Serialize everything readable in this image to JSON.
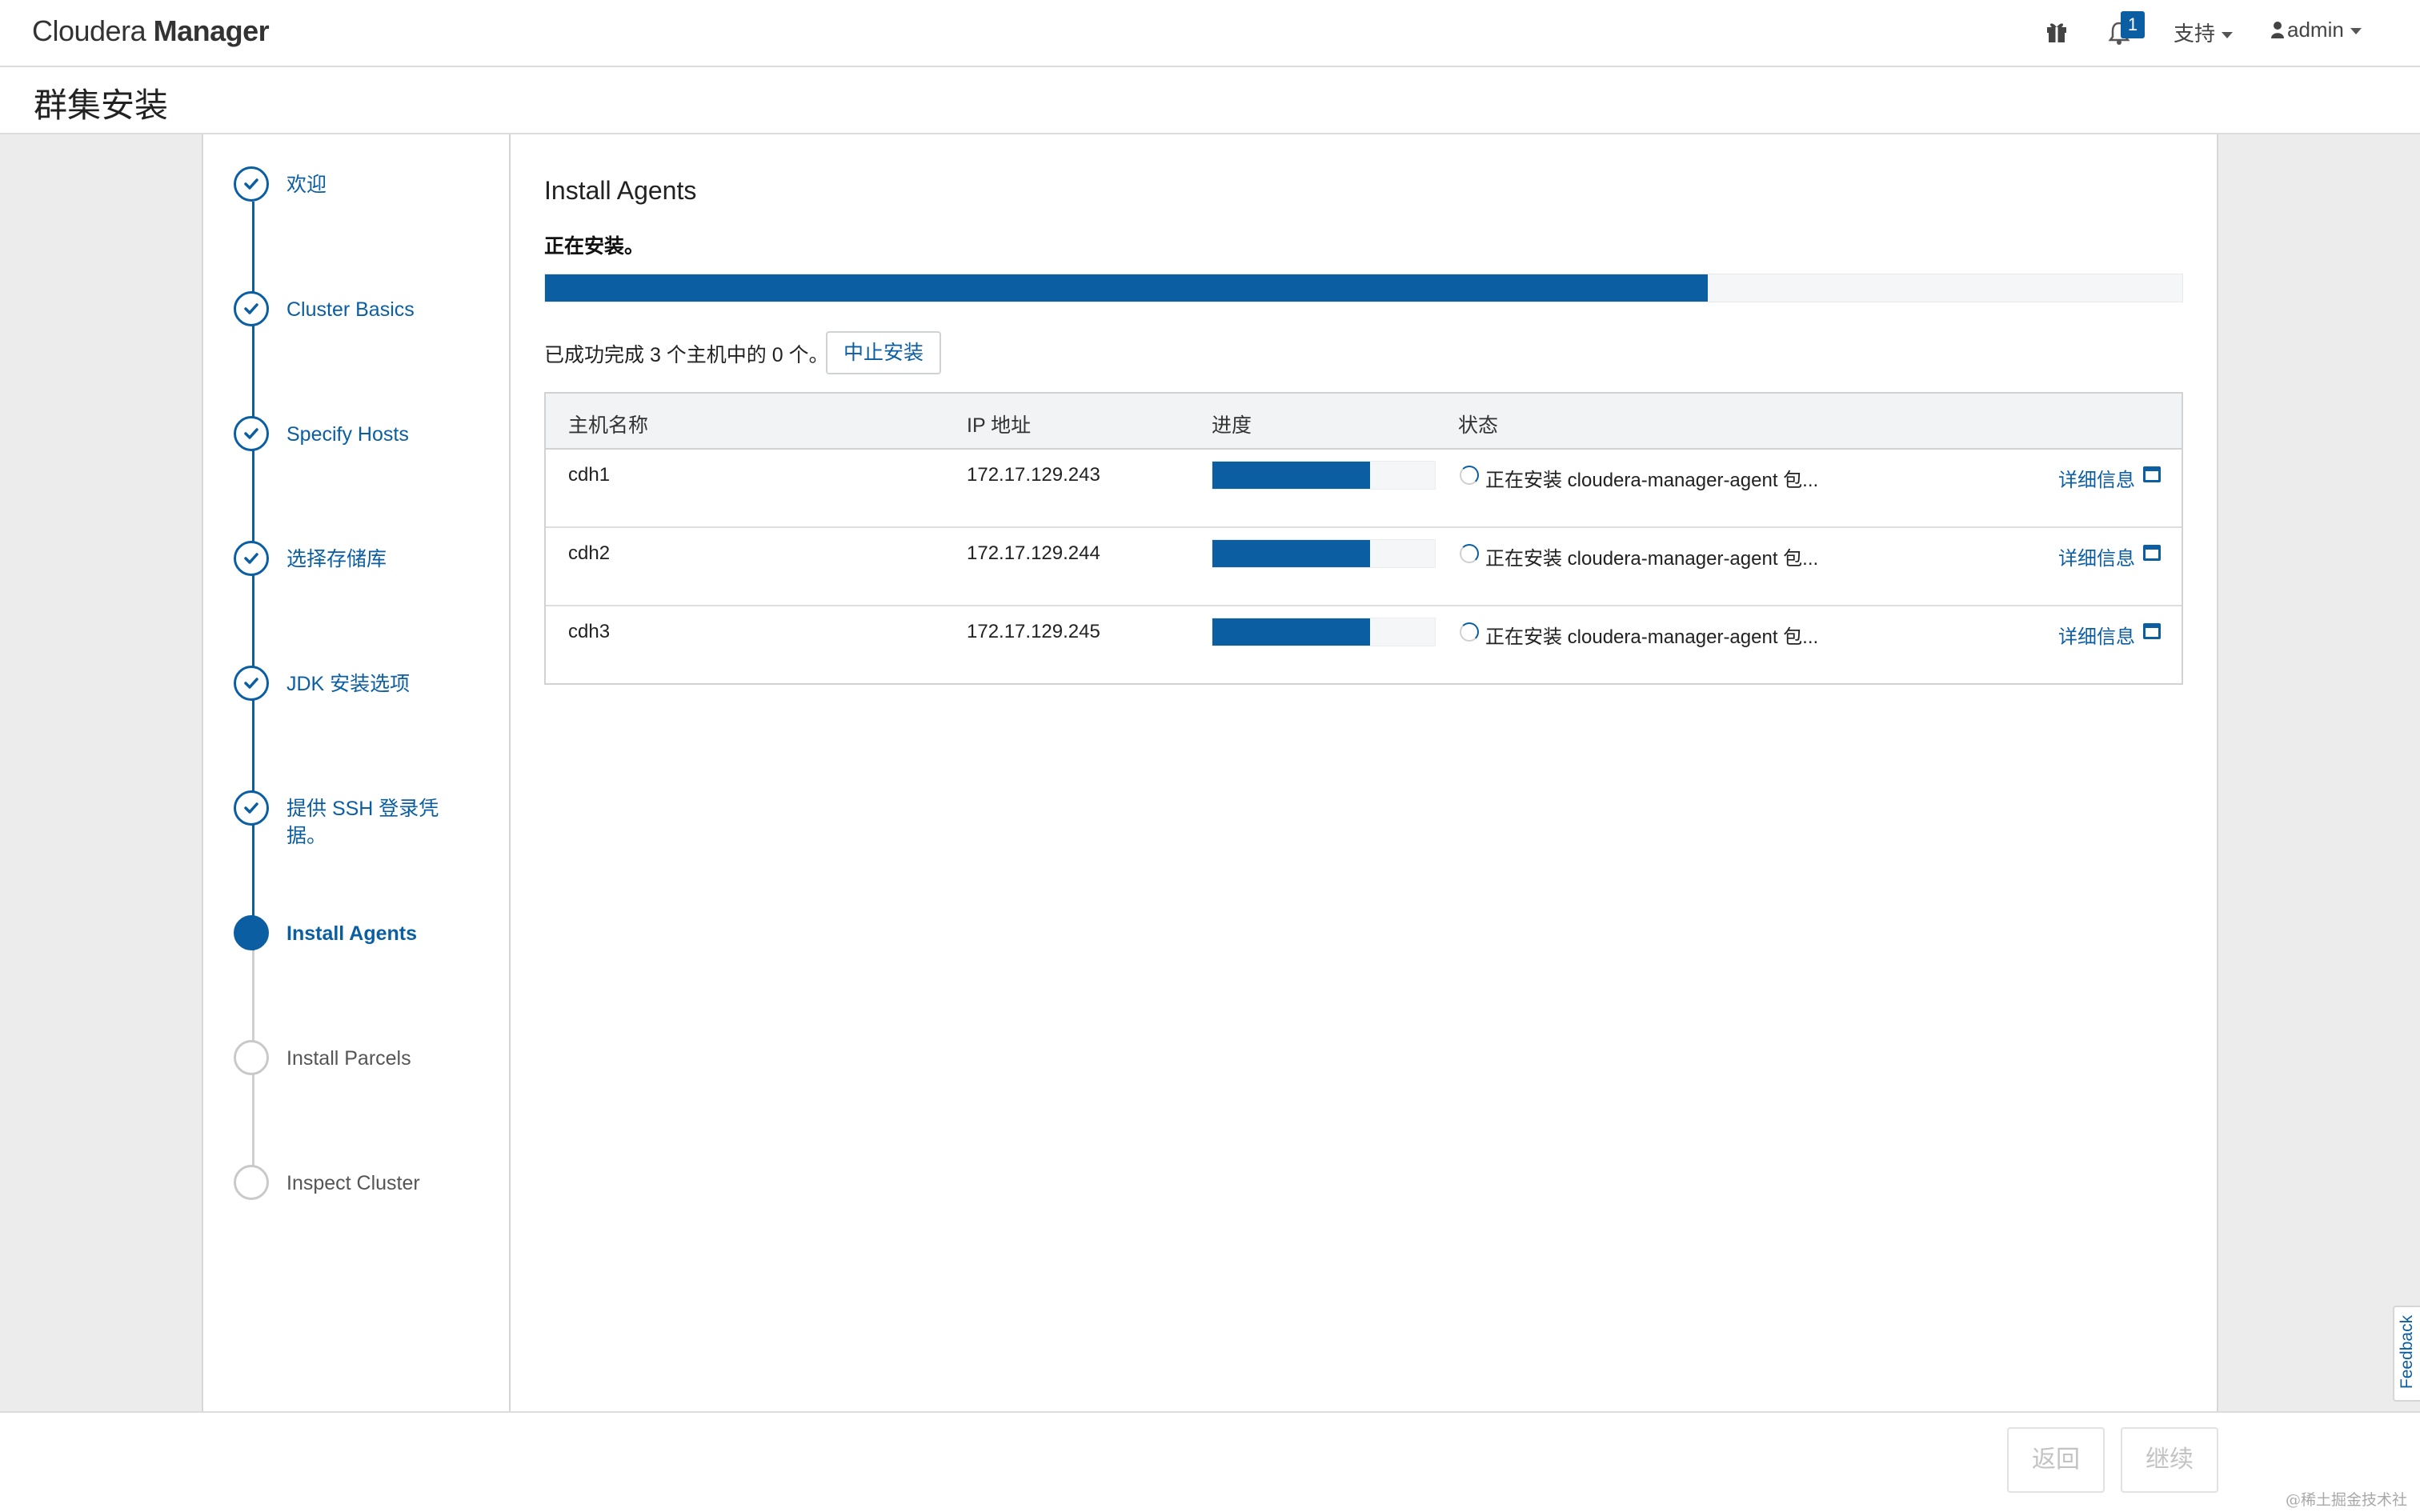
{
  "app": {
    "brand_light": "Cloudera",
    "brand_bold": "Manager",
    "page_title": "群集安装"
  },
  "nav": {
    "notification_count": "1",
    "support_label": "支持",
    "user_label": "admin",
    "icons": [
      "gift-icon",
      "bell-icon",
      "user-icon"
    ]
  },
  "steps": [
    {
      "label": "欢迎",
      "state": "done"
    },
    {
      "label": "Cluster Basics",
      "state": "done"
    },
    {
      "label": "Specify Hosts",
      "state": "done"
    },
    {
      "label": "选择存储库",
      "state": "done"
    },
    {
      "label": "JDK 安装选项",
      "state": "done"
    },
    {
      "label": "提供 SSH 登录凭据。",
      "state": "done"
    },
    {
      "label": "Install Agents",
      "state": "active"
    },
    {
      "label": "Install Parcels",
      "state": "pending"
    },
    {
      "label": "Inspect Cluster",
      "state": "pending"
    }
  ],
  "main": {
    "section_title": "Install Agents",
    "status_text": "正在安装。",
    "overall_progress": 0.71,
    "summary": "已成功完成 3 个主机中的 0 个。",
    "abort_label": "中止安装"
  },
  "table": {
    "headers": {
      "host": "主机名称",
      "ip": "IP 地址",
      "progress": "进度",
      "status": "状态"
    },
    "rows": [
      {
        "host": "cdh1",
        "ip": "172.17.129.243",
        "progress": 0.71,
        "status": "正在安装 cloudera-manager-agent 包...",
        "detail": "详细信息"
      },
      {
        "host": "cdh2",
        "ip": "172.17.129.244",
        "progress": 0.71,
        "status": "正在安装 cloudera-manager-agent 包...",
        "detail": "详细信息"
      },
      {
        "host": "cdh3",
        "ip": "172.17.129.245",
        "progress": 0.71,
        "status": "正在安装 cloudera-manager-agent 包...",
        "detail": "详细信息"
      }
    ]
  },
  "footer": {
    "back_label": "返回",
    "continue_label": "继续"
  },
  "feedback_label": "Feedback",
  "watermark": "@稀土掘金技术社区",
  "colors": {
    "accent": "#0b5ea1",
    "page_bg": "#ececec"
  }
}
